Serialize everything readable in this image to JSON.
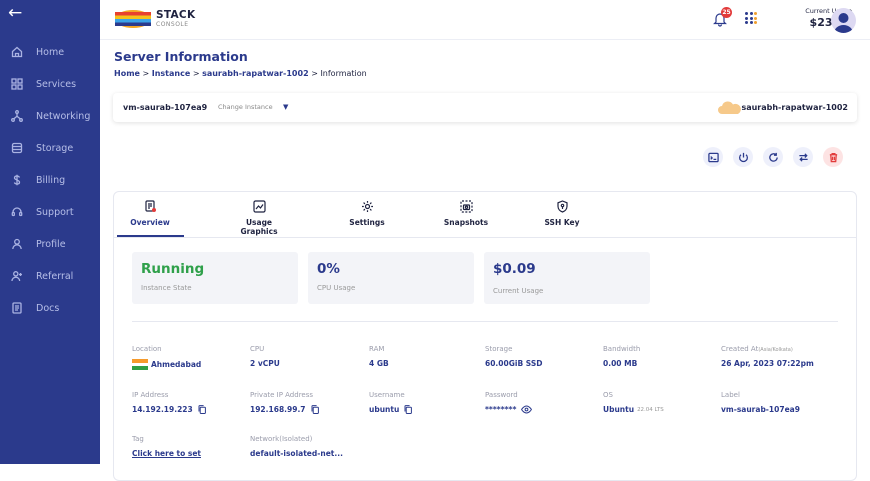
{
  "sidebar": {
    "back_icon": "arrow-left-icon",
    "items": [
      {
        "label": "Home",
        "icon": "home-icon"
      },
      {
        "label": "Services",
        "icon": "grid-icon"
      },
      {
        "label": "Networking",
        "icon": "network-icon"
      },
      {
        "label": "Storage",
        "icon": "database-icon"
      },
      {
        "label": "Billing",
        "icon": "dollar-icon"
      },
      {
        "label": "Support",
        "icon": "headset-icon"
      },
      {
        "label": "Profile",
        "icon": "user-icon"
      },
      {
        "label": "Referral",
        "icon": "user-plus-icon"
      },
      {
        "label": "Docs",
        "icon": "document-icon"
      }
    ]
  },
  "header": {
    "logo_title": "STACK",
    "logo_subtitle": "CONSOLE",
    "notification_count": "25",
    "usage_label": "Current Usage",
    "usage_value": "$23.44"
  },
  "page": {
    "title": "Server Information",
    "breadcrumb": [
      "Home",
      "Instance",
      "saurabh-rapatwar-1002",
      "Information"
    ]
  },
  "instance_bar": {
    "name": "vm-saurab-107ea9",
    "change_label": "Change Instance",
    "project": "saurabh-rapatwar-1002"
  },
  "actions": [
    "console-icon",
    "power-icon",
    "restart-icon",
    "transfer-icon",
    "delete-icon"
  ],
  "tabs": [
    {
      "label": "Overview",
      "icon": "overview-icon",
      "active": true
    },
    {
      "label": "Usage Graphics",
      "icon": "chart-icon"
    },
    {
      "label": "Settings",
      "icon": "gear-icon"
    },
    {
      "label": "Snapshots",
      "icon": "snapshot-icon"
    },
    {
      "label": "SSH Key",
      "icon": "key-icon"
    }
  ],
  "stats": [
    {
      "value": "Running",
      "label": "Instance State"
    },
    {
      "value": "0%",
      "label": "CPU Usage"
    },
    {
      "value": "$0.09",
      "label": "Current Usage"
    }
  ],
  "details": {
    "location": {
      "label": "Location",
      "value": "Ahmedabad"
    },
    "cpu": {
      "label": "CPU",
      "value": "2 vCPU"
    },
    "ram": {
      "label": "RAM",
      "value": "4 GB"
    },
    "storage": {
      "label": "Storage",
      "value": "60.00GiB SSD"
    },
    "bandwidth": {
      "label": "Bandwidth",
      "value": "0.00 MB"
    },
    "created": {
      "label": "Created At",
      "label_sub": "(Asia/Kolkata)",
      "value": "26 Apr, 2023 07:22pm"
    },
    "ip": {
      "label": "IP Address",
      "value": "14.192.19.223"
    },
    "private_ip": {
      "label": "Private IP Address",
      "value": "192.168.99.7"
    },
    "username": {
      "label": "Username",
      "value": "ubuntu"
    },
    "password": {
      "label": "Password",
      "value": "********"
    },
    "os": {
      "label": "OS",
      "value": "Ubuntu",
      "value_sub": "22.04 LTS"
    },
    "instance_label": {
      "label": "Label",
      "value": "vm-saurab-107ea9"
    },
    "tag": {
      "label": "Tag",
      "value": "Click here to set"
    },
    "network": {
      "label": "Network(Isolated)",
      "value": "default-isolated-net..."
    }
  },
  "colors": {
    "primary": "#2b3a8c",
    "running": "#2fa04a",
    "danger": "#e23b3b"
  }
}
